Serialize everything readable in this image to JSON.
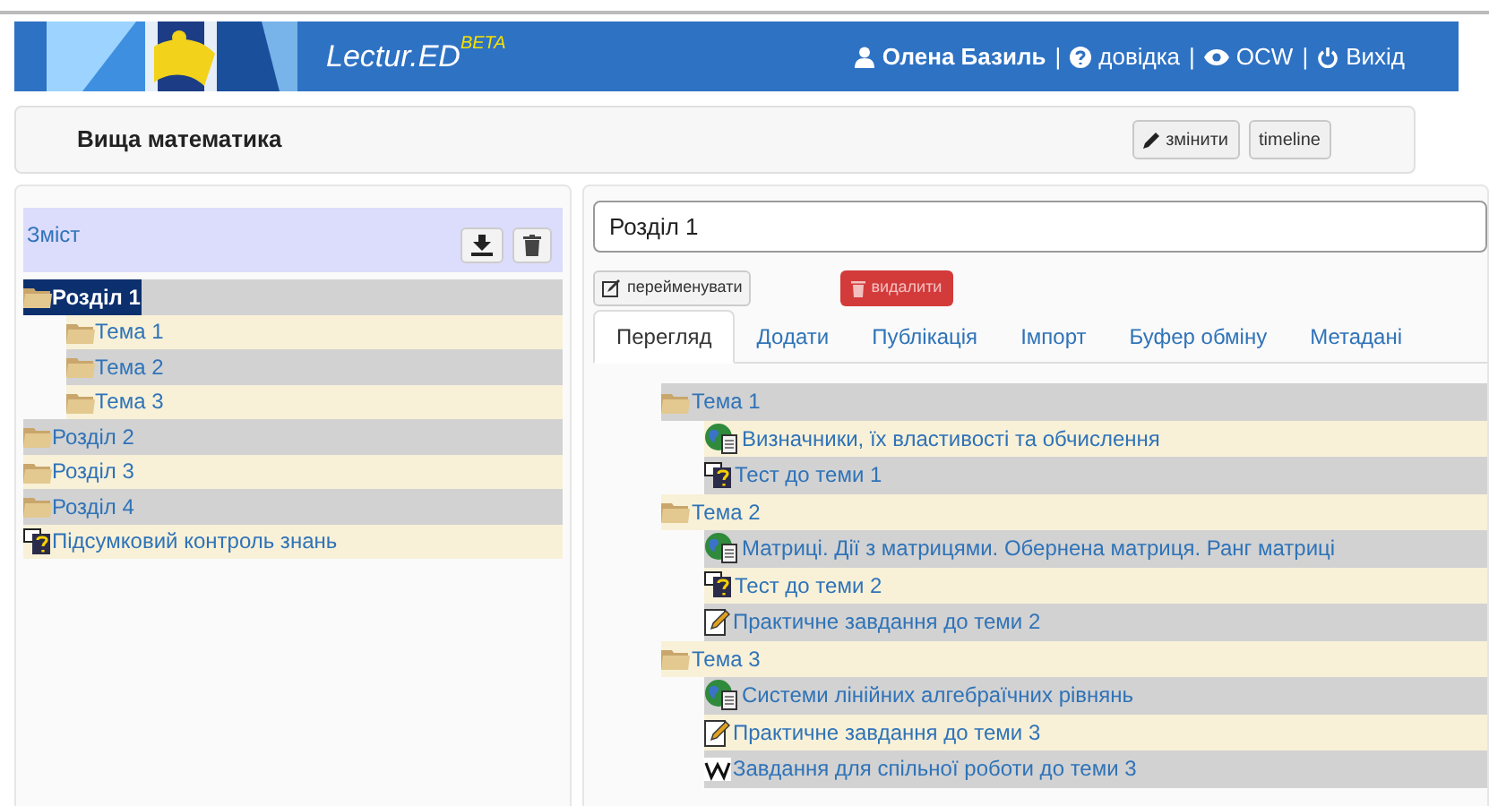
{
  "header": {
    "brand": "Lectur.ED",
    "brand_badge": "BETA",
    "separator": "|",
    "links": [
      {
        "kind": "user",
        "label": "Олена Базиль"
      },
      {
        "kind": "help",
        "label": "довідка"
      },
      {
        "kind": "eye",
        "label": "OCW"
      },
      {
        "kind": "power",
        "label": "Вихід"
      }
    ]
  },
  "course": {
    "title": "Вища математика",
    "buttons": [
      {
        "kind": "edit",
        "label": "змінити"
      },
      {
        "kind": "plain",
        "label": "timeline"
      }
    ]
  },
  "sidebar": {
    "title": "Зміст",
    "tree": [
      {
        "kind": "folder",
        "label": "Розділ 1",
        "selected": true,
        "children": [
          {
            "kind": "folder",
            "label": "Тема 1",
            "selected": false
          },
          {
            "kind": "folder",
            "label": "Тема 2",
            "selected": false
          },
          {
            "kind": "folder",
            "label": "Тема 3",
            "selected": false
          }
        ]
      },
      {
        "kind": "folder",
        "label": "Розділ 2",
        "selected": false
      },
      {
        "kind": "folder",
        "label": "Розділ 3",
        "selected": false
      },
      {
        "kind": "folder",
        "label": "Розділ 4",
        "selected": false
      },
      {
        "kind": "test",
        "label": "Підсумковий контроль знань",
        "selected": false
      }
    ]
  },
  "section": {
    "name_field": {
      "value": "Розділ 1"
    },
    "rename_button": "перейменувати",
    "delete_button": "видалити",
    "tabs": [
      {
        "label": "Перегляд",
        "selected": true
      },
      {
        "label": "Додати",
        "selected": false
      },
      {
        "label": "Публікація",
        "selected": false
      },
      {
        "label": "Імпорт",
        "selected": false
      },
      {
        "label": "Буфер обміну",
        "selected": false
      },
      {
        "label": "Метадані",
        "selected": false
      }
    ],
    "tree": [
      {
        "kind": "folder",
        "label": "Тема 1",
        "children": [
          {
            "kind": "lecture",
            "label": "Визначники, їх властивості та обчислення"
          },
          {
            "kind": "test",
            "label": "Тест до теми 1"
          }
        ]
      },
      {
        "kind": "folder",
        "label": "Тема 2",
        "children": [
          {
            "kind": "lecture",
            "label": "Матриці. Дії з матрицями. Обернена матриця. Ранг матриці"
          },
          {
            "kind": "test",
            "label": "Тест до теми 2"
          },
          {
            "kind": "task",
            "label": "Практичне завдання до теми 2"
          }
        ]
      },
      {
        "kind": "folder",
        "label": "Тема 3",
        "children": [
          {
            "kind": "lecture",
            "label": "Системи лінійних алгебраїчних рівнянь"
          },
          {
            "kind": "task",
            "label": "Практичне завдання до теми 3"
          },
          {
            "kind": "wiki",
            "label": "Завдання для спільної роботи до теми 3"
          }
        ]
      }
    ]
  }
}
